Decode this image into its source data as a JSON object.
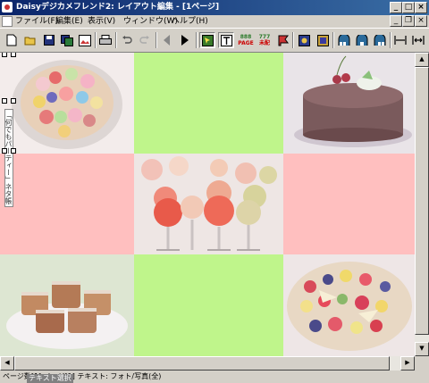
{
  "window": {
    "title": "Daisyデジカメフレンド2: レイアウト編集 - [1ページ]"
  },
  "menu": [
    {
      "label": "ファイル(F)"
    },
    {
      "label": "編集(E)"
    },
    {
      "label": "表示(V)"
    },
    {
      "label": "ウィンドウ(W)"
    },
    {
      "label": "ヘルプ(H)"
    }
  ],
  "toolbar": {
    "page_label": "PAGE",
    "page_number_label": "888",
    "hyakka_label": "未配",
    "hyakka_top_label": "777"
  },
  "canvas": {
    "cells": [
      {
        "kind": "photo",
        "name": "fruit-tart-photo",
        "subject": "fruit tart"
      },
      {
        "kind": "color",
        "color": "#bff58b"
      },
      {
        "kind": "photo",
        "name": "chocolate-cake-photo",
        "subject": "chocolate cake"
      },
      {
        "kind": "color",
        "color": "#ffbfbf"
      },
      {
        "kind": "photo",
        "name": "ice-cream-glasses-photo",
        "subject": "ice cream glasses"
      },
      {
        "kind": "color",
        "color": "#ffbfbf"
      },
      {
        "kind": "photo",
        "name": "pastries-plate-photo",
        "subject": "pastries plate"
      },
      {
        "kind": "color",
        "color": "#bff58b"
      },
      {
        "kind": "photo",
        "name": "berry-tart-photo",
        "subject": "berry tart"
      }
    ],
    "vertical_text": "「何でもパーティー」ネタ帳"
  },
  "status": {
    "text": "ページ数[1]  ページ[1]  テキスト: フォト/写真(全)",
    "hint": "テキスト選択"
  }
}
